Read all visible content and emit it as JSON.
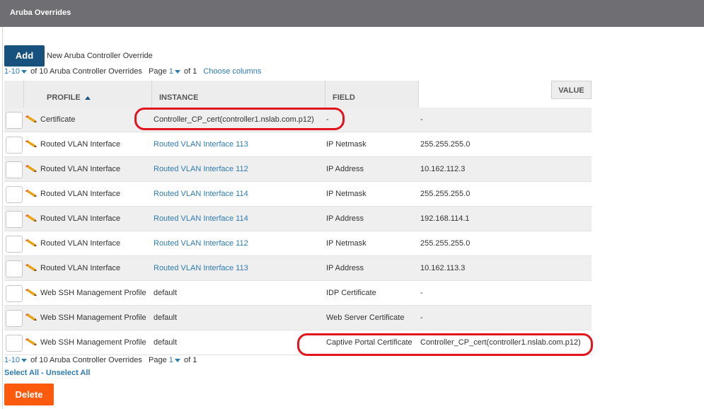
{
  "header": {
    "title": "Aruba Overrides"
  },
  "toolbar": {
    "add_label": "Add",
    "add_caption": "New Aruba Controller Override"
  },
  "pager_top": {
    "range": "1-10",
    "total_text": "of 10 Aruba Controller Overrides",
    "page_label": "Page",
    "page": "1",
    "of_text": "of 1",
    "choose_columns": "Choose columns"
  },
  "pager_bottom": {
    "range": "1-10",
    "total_text": "of 10 Aruba Controller Overrides",
    "page_label": "Page",
    "page": "1",
    "of_text": "of 1"
  },
  "table": {
    "headers": {
      "profile": "PROFILE",
      "instance": "INSTANCE",
      "field": "FIELD",
      "value": "VALUE"
    },
    "rows": [
      {
        "profile": "Certificate",
        "instance": "Controller_CP_cert(controller1.nslab.com.p12)",
        "field": "-",
        "value": "-"
      },
      {
        "profile": "Routed VLAN Interface",
        "instance": "Routed VLAN Interface 113",
        "field": "IP Netmask",
        "value": "255.255.255.0"
      },
      {
        "profile": "Routed VLAN Interface",
        "instance": "Routed VLAN Interface 112",
        "field": "IP Address",
        "value": "10.162.112.3"
      },
      {
        "profile": "Routed VLAN Interface",
        "instance": "Routed VLAN Interface 114",
        "field": "IP Netmask",
        "value": "255.255.255.0"
      },
      {
        "profile": "Routed VLAN Interface",
        "instance": "Routed VLAN Interface 114",
        "field": "IP Address",
        "value": "192.168.114.1"
      },
      {
        "profile": "Routed VLAN Interface",
        "instance": "Routed VLAN Interface 112",
        "field": "IP Netmask",
        "value": "255.255.255.0"
      },
      {
        "profile": "Routed VLAN Interface",
        "instance": "Routed VLAN Interface 113",
        "field": "IP Address",
        "value": "10.162.113.3"
      },
      {
        "profile": "Web SSH Management Profile",
        "instance": "default",
        "field": "IDP Certificate",
        "value": "-"
      },
      {
        "profile": "Web SSH Management Profile",
        "instance": "default",
        "field": "Web Server Certificate",
        "value": "-"
      },
      {
        "profile": "Web SSH Management Profile",
        "instance": "default",
        "field": "Captive Portal Certificate",
        "value": "Controller_CP_cert(controller1.nslab.com.p12)"
      }
    ]
  },
  "selection": {
    "select_all": "Select All",
    "separator": " - ",
    "unselect_all": "Unselect All"
  },
  "actions": {
    "delete_label": "Delete"
  },
  "colors": {
    "header_bg": "#6f6f73",
    "add_button": "#17517d",
    "link": "#2e7bb4",
    "delete_button": "#fc5a0d",
    "highlight": "#e2141c"
  }
}
